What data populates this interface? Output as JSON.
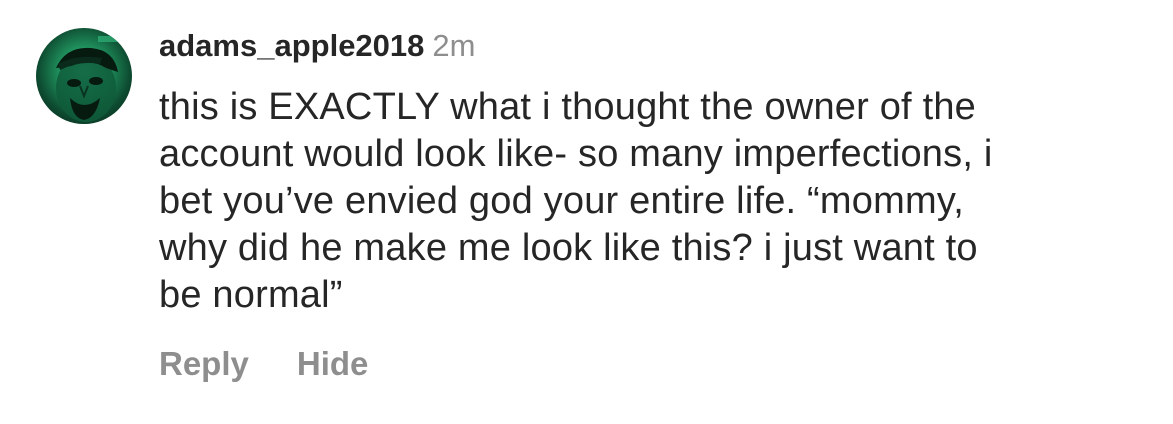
{
  "comment": {
    "username": "adams_apple2018",
    "timestamp": "2m",
    "text_lines": [
      "this is EXACTLY what i thought the owner of the",
      "account would look like- so many imperfections, i",
      "bet you’ve envied god your entire life. “mommy,",
      "why did he make me look like this? i just want to",
      "be normal”"
    ],
    "avatar_icon": "profile-photo",
    "actions": {
      "reply_label": "Reply",
      "hide_label": "Hide"
    }
  },
  "colors": {
    "text": "#262626",
    "muted": "#8e8e8e",
    "avatar_accent": "#3bd18f"
  }
}
